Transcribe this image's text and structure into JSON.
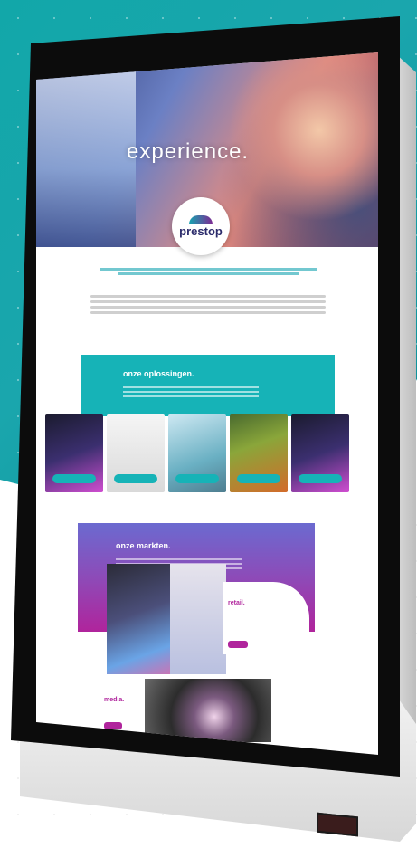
{
  "screen": {
    "hero": {
      "title": "experience."
    },
    "logo": {
      "text": "prestop"
    },
    "solutions": {
      "title": "onze oplossingen."
    },
    "markets": {
      "title": "onze markten."
    },
    "retail": {
      "title": "retail."
    },
    "media": {
      "title": "media."
    }
  },
  "colors": {
    "teal": "#16b3b7",
    "magenta": "#b0249c",
    "purple": "#6b6ad0"
  }
}
